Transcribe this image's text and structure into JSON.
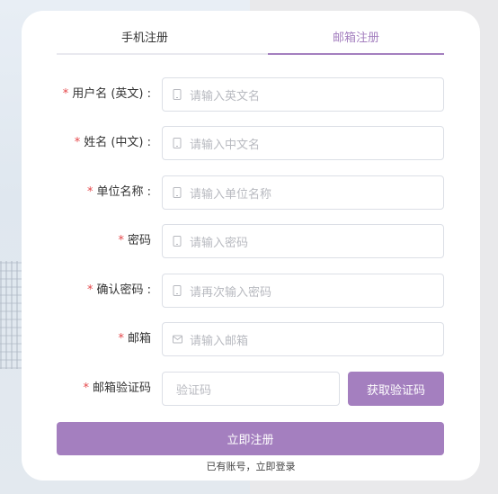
{
  "tabs": [
    {
      "label": "手机注册",
      "active": false
    },
    {
      "label": "邮箱注册",
      "active": true
    }
  ],
  "accent_color": "#a47fbf",
  "required_color": "#e5474a",
  "required_mark": "*",
  "fields": [
    {
      "label": "用户名 (英文) :",
      "placeholder": "请输入英文名",
      "icon": "phone-icon"
    },
    {
      "label": "姓名 (中文) :",
      "placeholder": "请输入中文名",
      "icon": "phone-icon"
    },
    {
      "label": "单位名称 :",
      "placeholder": "请输入单位名称",
      "icon": "phone-icon"
    },
    {
      "label": "密码",
      "placeholder": "请输入密码",
      "icon": "phone-icon"
    },
    {
      "label": "确认密码 :",
      "placeholder": "请再次输入密码",
      "icon": "phone-icon"
    },
    {
      "label": "邮箱",
      "placeholder": "请输入邮箱",
      "icon": "mail-icon"
    }
  ],
  "email_code": {
    "label": "邮箱验证码",
    "placeholder": "验证码",
    "button_label": "获取验证码"
  },
  "submit_label": "立即注册",
  "login_link": "已有账号，立即登录"
}
